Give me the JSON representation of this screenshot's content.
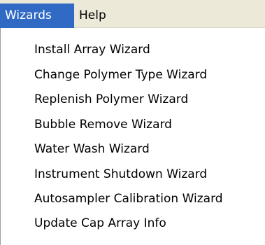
{
  "menubar": {
    "items": [
      {
        "label": "Wizards",
        "active": true
      },
      {
        "label": "Help",
        "active": false
      }
    ],
    "active_color": "#316ac5"
  },
  "dropdown": {
    "items": [
      {
        "label": "Install Array Wizard"
      },
      {
        "label": "Change Polymer Type Wizard"
      },
      {
        "label": "Replenish Polymer Wizard"
      },
      {
        "label": "Bubble Remove Wizard"
      },
      {
        "label": "Water Wash Wizard"
      },
      {
        "label": "Instrument Shutdown Wizard"
      },
      {
        "label": "Autosampler Calibration Wizard"
      },
      {
        "label": "Update Cap Array Info"
      }
    ]
  }
}
